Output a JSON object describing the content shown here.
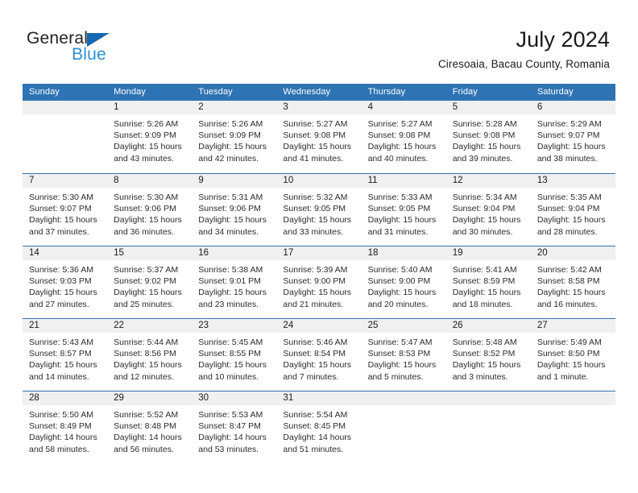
{
  "logo": {
    "word_one": "General",
    "word_two": "Blue",
    "triangle_icon": "triangle-icon",
    "brand_dark": "#231f20",
    "brand_blue": "#2a8fd4",
    "triangle_blue": "#1668b3"
  },
  "header": {
    "title": "July 2024",
    "subtitle": "Ciresoaia, Bacau County, Romania"
  },
  "theme": {
    "header_blue": "#2e73b3",
    "daynum_gray": "#f0f0f0",
    "text": "#2b2b2b"
  },
  "weekdays": [
    "Sunday",
    "Monday",
    "Tuesday",
    "Wednesday",
    "Thursday",
    "Friday",
    "Saturday"
  ],
  "labels": {
    "sunrise": "Sunrise:",
    "sunset": "Sunset:",
    "daylight": "Daylight:"
  },
  "weeks": [
    [
      {
        "day": ""
      },
      {
        "day": "1",
        "sunrise": "Sunrise: 5:26 AM",
        "sunset": "Sunset: 9:09 PM",
        "daylight_1": "Daylight: 15 hours",
        "daylight_2": "and 43 minutes."
      },
      {
        "day": "2",
        "sunrise": "Sunrise: 5:26 AM",
        "sunset": "Sunset: 9:09 PM",
        "daylight_1": "Daylight: 15 hours",
        "daylight_2": "and 42 minutes."
      },
      {
        "day": "3",
        "sunrise": "Sunrise: 5:27 AM",
        "sunset": "Sunset: 9:08 PM",
        "daylight_1": "Daylight: 15 hours",
        "daylight_2": "and 41 minutes."
      },
      {
        "day": "4",
        "sunrise": "Sunrise: 5:27 AM",
        "sunset": "Sunset: 9:08 PM",
        "daylight_1": "Daylight: 15 hours",
        "daylight_2": "and 40 minutes."
      },
      {
        "day": "5",
        "sunrise": "Sunrise: 5:28 AM",
        "sunset": "Sunset: 9:08 PM",
        "daylight_1": "Daylight: 15 hours",
        "daylight_2": "and 39 minutes."
      },
      {
        "day": "6",
        "sunrise": "Sunrise: 5:29 AM",
        "sunset": "Sunset: 9:07 PM",
        "daylight_1": "Daylight: 15 hours",
        "daylight_2": "and 38 minutes."
      }
    ],
    [
      {
        "day": "7",
        "sunrise": "Sunrise: 5:30 AM",
        "sunset": "Sunset: 9:07 PM",
        "daylight_1": "Daylight: 15 hours",
        "daylight_2": "and 37 minutes."
      },
      {
        "day": "8",
        "sunrise": "Sunrise: 5:30 AM",
        "sunset": "Sunset: 9:06 PM",
        "daylight_1": "Daylight: 15 hours",
        "daylight_2": "and 36 minutes."
      },
      {
        "day": "9",
        "sunrise": "Sunrise: 5:31 AM",
        "sunset": "Sunset: 9:06 PM",
        "daylight_1": "Daylight: 15 hours",
        "daylight_2": "and 34 minutes."
      },
      {
        "day": "10",
        "sunrise": "Sunrise: 5:32 AM",
        "sunset": "Sunset: 9:05 PM",
        "daylight_1": "Daylight: 15 hours",
        "daylight_2": "and 33 minutes."
      },
      {
        "day": "11",
        "sunrise": "Sunrise: 5:33 AM",
        "sunset": "Sunset: 9:05 PM",
        "daylight_1": "Daylight: 15 hours",
        "daylight_2": "and 31 minutes."
      },
      {
        "day": "12",
        "sunrise": "Sunrise: 5:34 AM",
        "sunset": "Sunset: 9:04 PM",
        "daylight_1": "Daylight: 15 hours",
        "daylight_2": "and 30 minutes."
      },
      {
        "day": "13",
        "sunrise": "Sunrise: 5:35 AM",
        "sunset": "Sunset: 9:04 PM",
        "daylight_1": "Daylight: 15 hours",
        "daylight_2": "and 28 minutes."
      }
    ],
    [
      {
        "day": "14",
        "sunrise": "Sunrise: 5:36 AM",
        "sunset": "Sunset: 9:03 PM",
        "daylight_1": "Daylight: 15 hours",
        "daylight_2": "and 27 minutes."
      },
      {
        "day": "15",
        "sunrise": "Sunrise: 5:37 AM",
        "sunset": "Sunset: 9:02 PM",
        "daylight_1": "Daylight: 15 hours",
        "daylight_2": "and 25 minutes."
      },
      {
        "day": "16",
        "sunrise": "Sunrise: 5:38 AM",
        "sunset": "Sunset: 9:01 PM",
        "daylight_1": "Daylight: 15 hours",
        "daylight_2": "and 23 minutes."
      },
      {
        "day": "17",
        "sunrise": "Sunrise: 5:39 AM",
        "sunset": "Sunset: 9:00 PM",
        "daylight_1": "Daylight: 15 hours",
        "daylight_2": "and 21 minutes."
      },
      {
        "day": "18",
        "sunrise": "Sunrise: 5:40 AM",
        "sunset": "Sunset: 9:00 PM",
        "daylight_1": "Daylight: 15 hours",
        "daylight_2": "and 20 minutes."
      },
      {
        "day": "19",
        "sunrise": "Sunrise: 5:41 AM",
        "sunset": "Sunset: 8:59 PM",
        "daylight_1": "Daylight: 15 hours",
        "daylight_2": "and 18 minutes."
      },
      {
        "day": "20",
        "sunrise": "Sunrise: 5:42 AM",
        "sunset": "Sunset: 8:58 PM",
        "daylight_1": "Daylight: 15 hours",
        "daylight_2": "and 16 minutes."
      }
    ],
    [
      {
        "day": "21",
        "sunrise": "Sunrise: 5:43 AM",
        "sunset": "Sunset: 8:57 PM",
        "daylight_1": "Daylight: 15 hours",
        "daylight_2": "and 14 minutes."
      },
      {
        "day": "22",
        "sunrise": "Sunrise: 5:44 AM",
        "sunset": "Sunset: 8:56 PM",
        "daylight_1": "Daylight: 15 hours",
        "daylight_2": "and 12 minutes."
      },
      {
        "day": "23",
        "sunrise": "Sunrise: 5:45 AM",
        "sunset": "Sunset: 8:55 PM",
        "daylight_1": "Daylight: 15 hours",
        "daylight_2": "and 10 minutes."
      },
      {
        "day": "24",
        "sunrise": "Sunrise: 5:46 AM",
        "sunset": "Sunset: 8:54 PM",
        "daylight_1": "Daylight: 15 hours",
        "daylight_2": "and 7 minutes."
      },
      {
        "day": "25",
        "sunrise": "Sunrise: 5:47 AM",
        "sunset": "Sunset: 8:53 PM",
        "daylight_1": "Daylight: 15 hours",
        "daylight_2": "and 5 minutes."
      },
      {
        "day": "26",
        "sunrise": "Sunrise: 5:48 AM",
        "sunset": "Sunset: 8:52 PM",
        "daylight_1": "Daylight: 15 hours",
        "daylight_2": "and 3 minutes."
      },
      {
        "day": "27",
        "sunrise": "Sunrise: 5:49 AM",
        "sunset": "Sunset: 8:50 PM",
        "daylight_1": "Daylight: 15 hours",
        "daylight_2": "and 1 minute."
      }
    ],
    [
      {
        "day": "28",
        "sunrise": "Sunrise: 5:50 AM",
        "sunset": "Sunset: 8:49 PM",
        "daylight_1": "Daylight: 14 hours",
        "daylight_2": "and 58 minutes."
      },
      {
        "day": "29",
        "sunrise": "Sunrise: 5:52 AM",
        "sunset": "Sunset: 8:48 PM",
        "daylight_1": "Daylight: 14 hours",
        "daylight_2": "and 56 minutes."
      },
      {
        "day": "30",
        "sunrise": "Sunrise: 5:53 AM",
        "sunset": "Sunset: 8:47 PM",
        "daylight_1": "Daylight: 14 hours",
        "daylight_2": "and 53 minutes."
      },
      {
        "day": "31",
        "sunrise": "Sunrise: 5:54 AM",
        "sunset": "Sunset: 8:45 PM",
        "daylight_1": "Daylight: 14 hours",
        "daylight_2": "and 51 minutes."
      },
      {
        "day": ""
      },
      {
        "day": ""
      },
      {
        "day": ""
      }
    ]
  ]
}
